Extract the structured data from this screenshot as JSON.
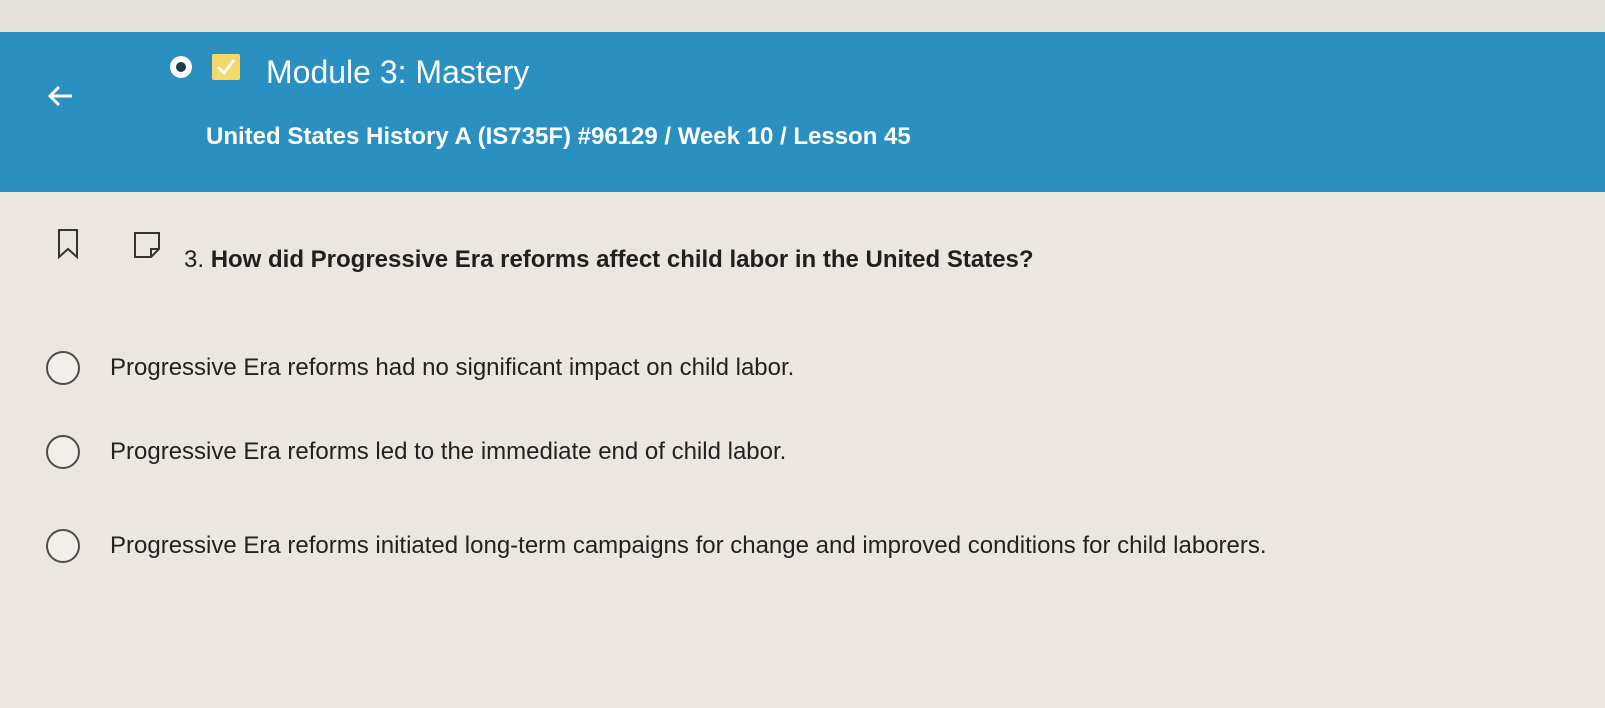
{
  "colors": {
    "header_background": "#2a8fc1",
    "page_background": "#ebe7e0",
    "check_badge": "#f5d86a"
  },
  "header": {
    "back_icon": "arrow-left-icon",
    "status_icon": "status-dot-icon",
    "check_icon": "checkmark-icon",
    "title": "Module 3: Mastery",
    "breadcrumb": "United States History A (IS735F) #96129 / Week 10 / Lesson 45"
  },
  "tools": {
    "bookmark_icon": "bookmark-icon",
    "note_icon": "note-icon"
  },
  "question": {
    "number": "3.",
    "text": "How did Progressive Era reforms affect child labor in the United States?"
  },
  "options": [
    {
      "label": "Progressive Era reforms had no significant impact on child labor.",
      "selected": false
    },
    {
      "label": "Progressive Era reforms led to the immediate end of child labor.",
      "selected": false
    },
    {
      "label": "Progressive Era reforms initiated long-term campaigns for change and improved conditions for child laborers.",
      "selected": false
    }
  ]
}
